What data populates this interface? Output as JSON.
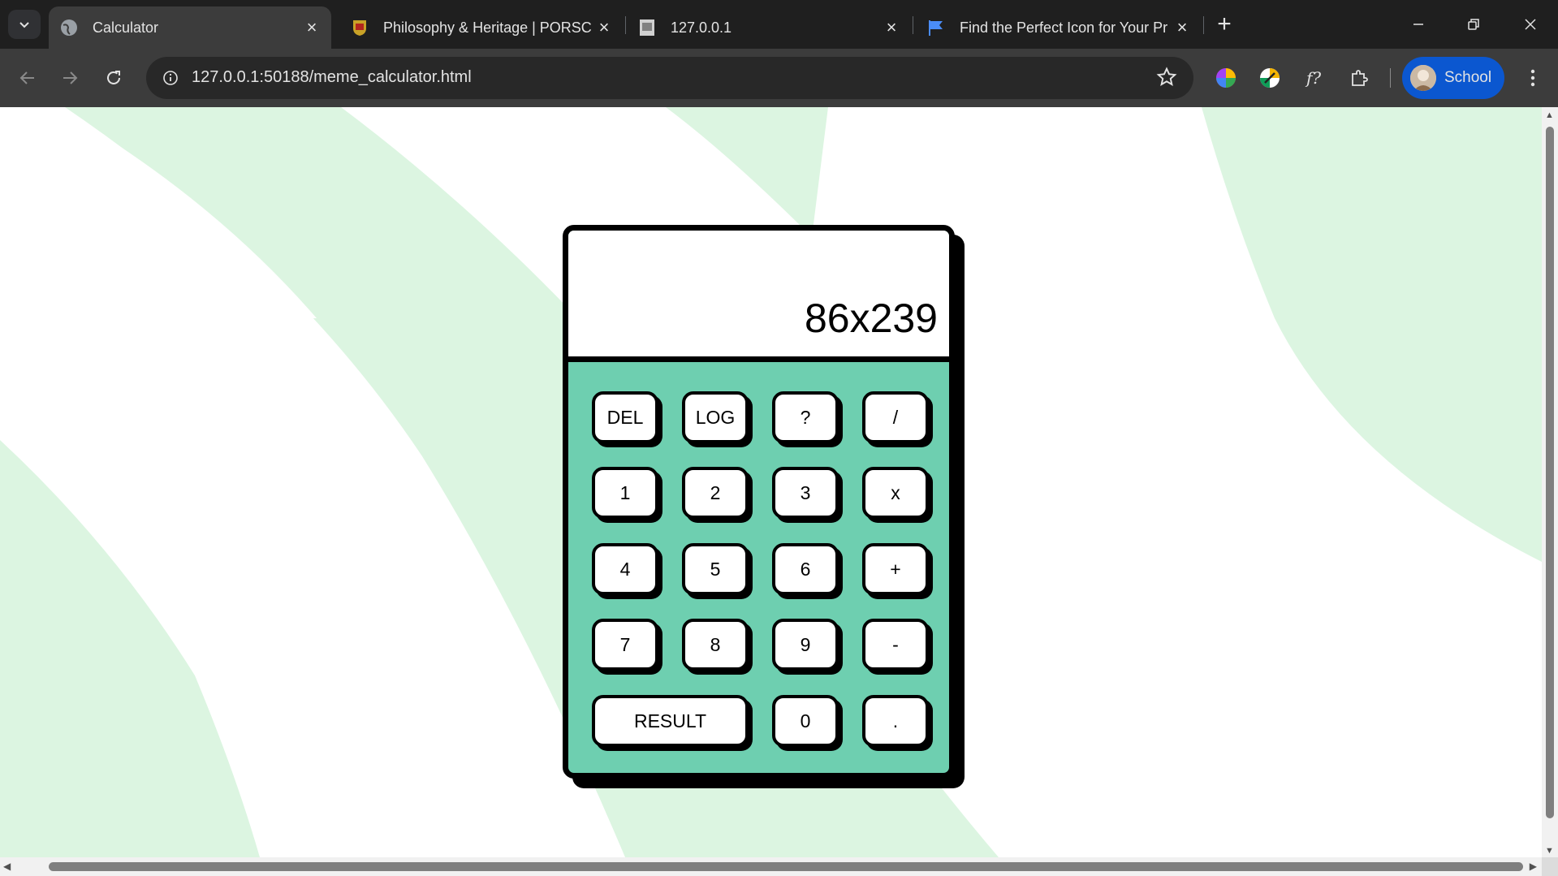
{
  "browser": {
    "tabs": [
      {
        "title": "Calculator",
        "active": true
      },
      {
        "title": "Philosophy & Heritage | PORSC",
        "active": false
      },
      {
        "title": "127.0.0.1",
        "active": false
      },
      {
        "title": "Find the Perfect Icon for Your Pr",
        "active": false
      }
    ],
    "url": "127.0.0.1:50188/meme_calculator.html",
    "profile_label": "School"
  },
  "calculator": {
    "display": "86x239",
    "keys": {
      "del": "DEL",
      "log": "LOG",
      "question": "?",
      "divide": "/",
      "k1": "1",
      "k2": "2",
      "k3": "3",
      "multiply": "x",
      "k4": "4",
      "k5": "5",
      "k6": "6",
      "plus": "+",
      "k7": "7",
      "k8": "8",
      "k9": "9",
      "minus": "-",
      "result": "RESULT",
      "k0": "0",
      "dot": "."
    }
  },
  "colors": {
    "calculator_body": "#6ecfb0",
    "background_wave": "#dcf5e1",
    "profile_chip": "#0b57d0"
  }
}
